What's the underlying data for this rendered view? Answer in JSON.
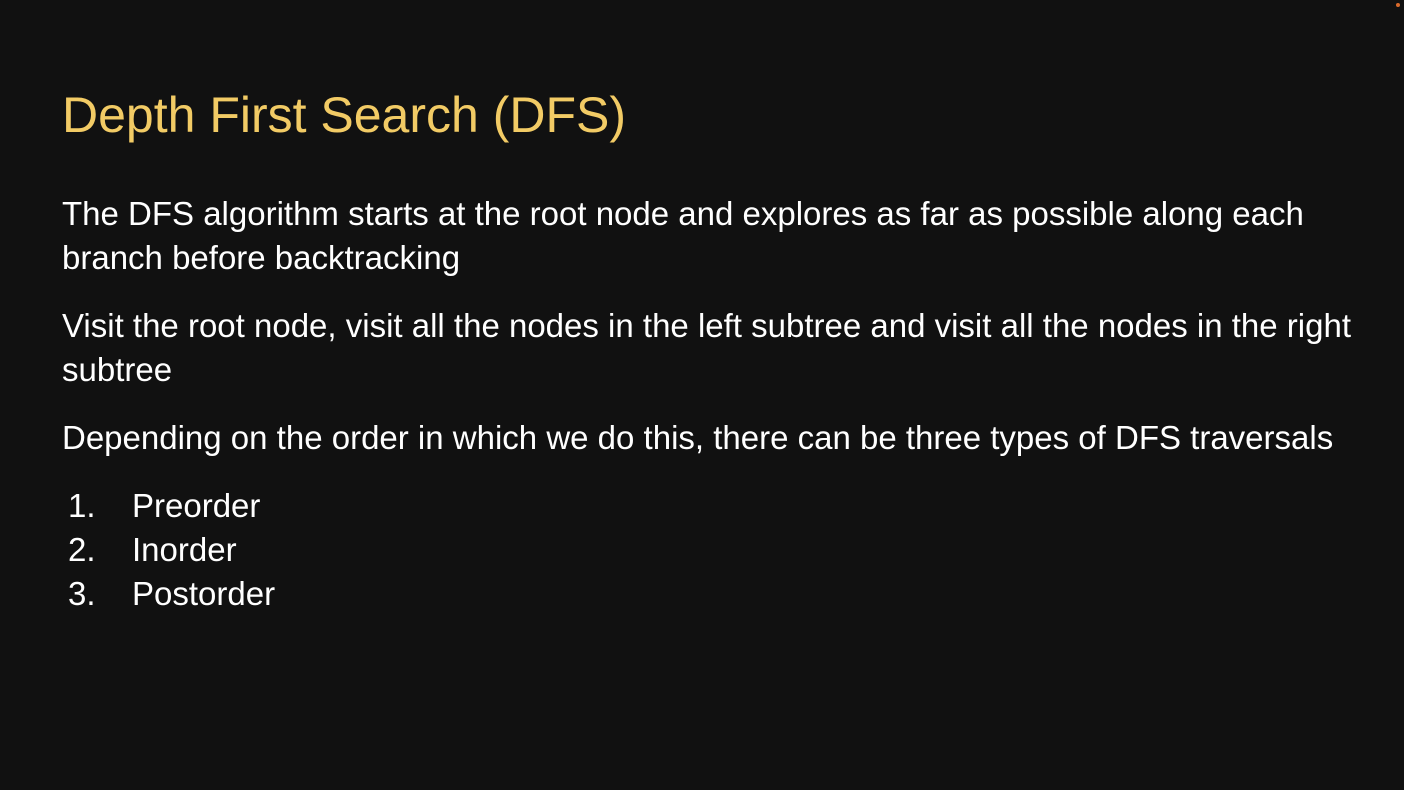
{
  "theme": {
    "background": "#111111",
    "title_color": "#f2cb65",
    "text_color": "#ffffff",
    "indicator_color": "#d96a2b"
  },
  "slide": {
    "title": "Depth First Search (DFS)",
    "paragraphs": [
      "The DFS algorithm starts at the root node and explores as far as possible along each branch before backtracking",
      "Visit the root node, visit all the nodes in the left subtree and visit all the nodes in the right subtree",
      "Depending on the order in which we do this, there can be three types of DFS traversals"
    ],
    "list": [
      {
        "number": "1.",
        "label": "Preorder"
      },
      {
        "number": "2.",
        "label": "Inorder"
      },
      {
        "number": "3.",
        "label": "Postorder"
      }
    ]
  }
}
